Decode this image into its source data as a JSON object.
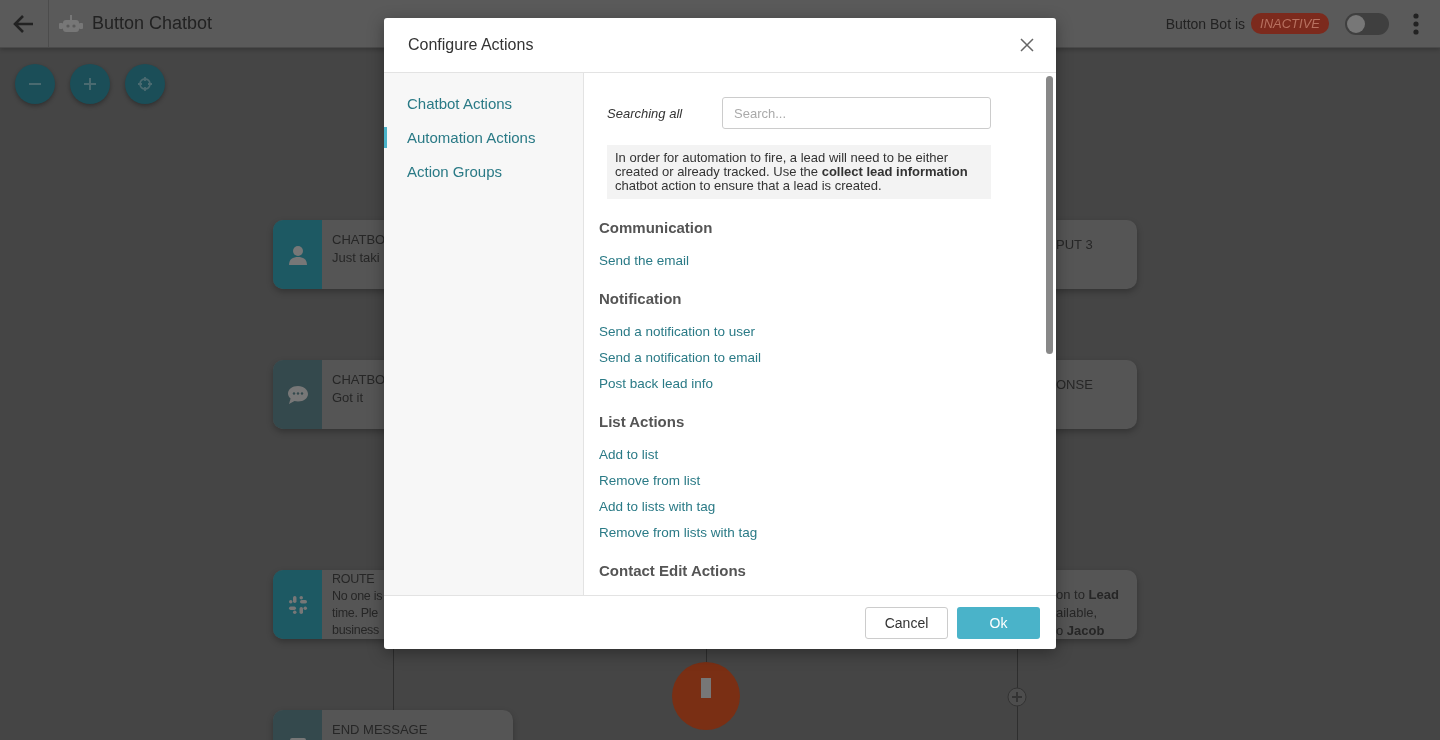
{
  "header": {
    "title": "Button Chatbot",
    "status_label": "Button Bot is",
    "status_badge": "INACTIVE",
    "toggle": {
      "on": false
    }
  },
  "canvas": {
    "nodes": [
      {
        "kind": "contact",
        "lines": [
          "CHATBO",
          "Just taki"
        ]
      },
      {
        "kind": "chat",
        "lines": [
          "CHATBO",
          "Got it"
        ]
      },
      {
        "kind": "slack",
        "lines": [
          "ROUTE",
          "No one is",
          "time. Ple",
          "business"
        ]
      },
      {
        "kind": "end",
        "lines": [
          "END MESSAGE"
        ]
      },
      {
        "kind": "plain",
        "lines": [
          "PUT 3"
        ]
      },
      {
        "kind": "plain",
        "lines": [
          "ONSE"
        ]
      },
      {
        "kind": "plain",
        "lines": [
          "on to **Lead**",
          "ailable,",
          "o **Jacob**"
        ]
      }
    ]
  },
  "modal": {
    "title": "Configure Actions",
    "nav": [
      {
        "label": "Chatbot Actions",
        "selected": false
      },
      {
        "label": "Automation Actions",
        "selected": true
      },
      {
        "label": "Action Groups",
        "selected": false
      }
    ],
    "search_label": "Searching all",
    "search": {
      "placeholder": "Search..."
    },
    "notice": "In order for automation to fire, a lead will need to be either created or already tracked. Use the **collect lead information** chatbot action to ensure that a lead is created.",
    "sections": [
      {
        "heading": "Communication",
        "actions": [
          "Send the email"
        ]
      },
      {
        "heading": "Notification",
        "actions": [
          "Send a notification to user",
          "Send a notification to email",
          "Post back lead info"
        ]
      },
      {
        "heading": "List Actions",
        "actions": [
          "Add to list",
          "Remove from list",
          "Add to lists with tag",
          "Remove from lists with tag"
        ]
      },
      {
        "heading": "Contact Edit Actions"
      }
    ],
    "buttons": {
      "cancel": "Cancel",
      "ok": "Ok"
    }
  }
}
